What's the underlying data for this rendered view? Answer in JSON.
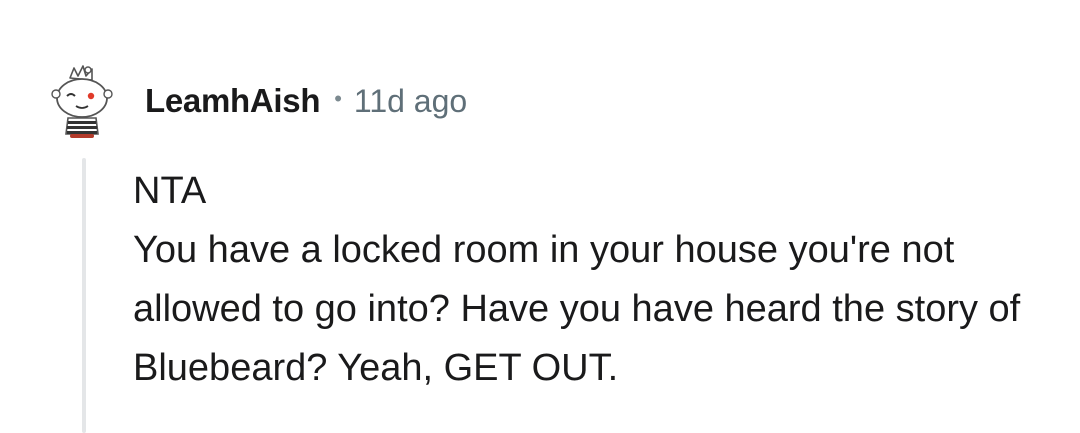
{
  "comment": {
    "author": "LeamhAish",
    "separator": "•",
    "timestamp": "11d ago",
    "body_lines": [
      "NTA",
      "You have a locked room in your house you're not allowed to go into? Have you have heard the story of Bluebeard? Yeah, GET OUT."
    ],
    "avatar_icon": "reddit-snoo-avatar-icon"
  },
  "colors": {
    "text_primary": "#1a1a1b",
    "text_meta": "#5f6f78",
    "thread_line": "#e4e6e8",
    "avatar_accent": "#e03a2a"
  }
}
